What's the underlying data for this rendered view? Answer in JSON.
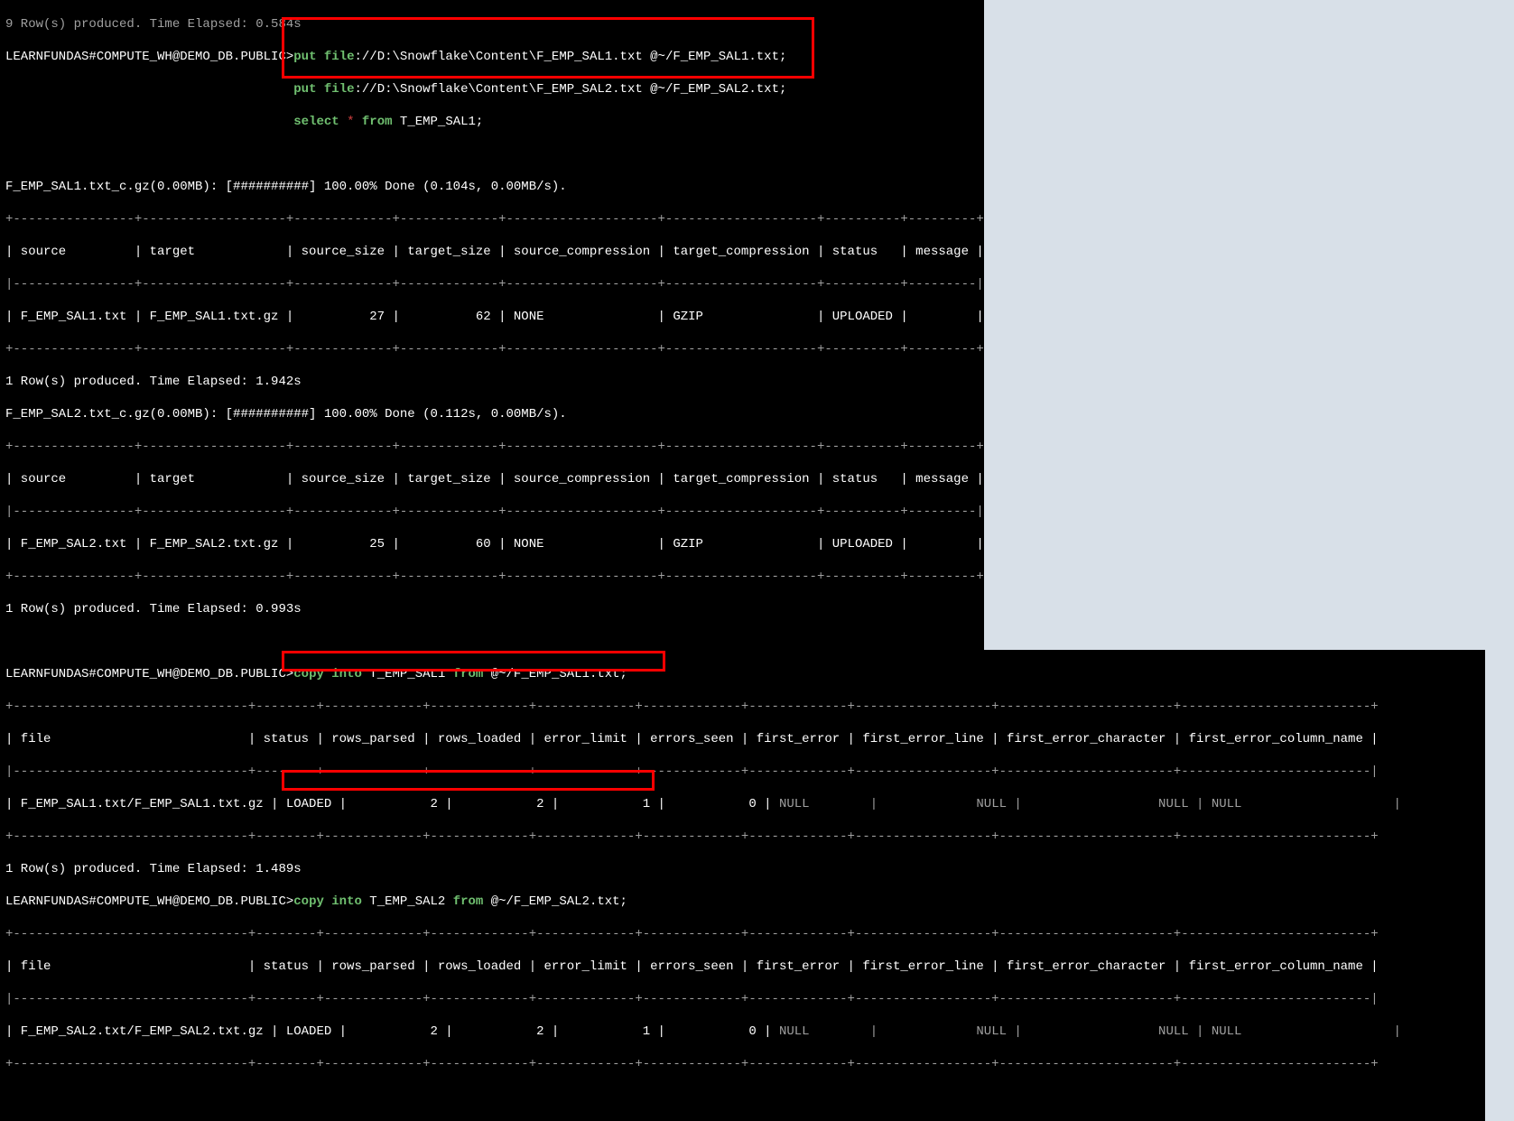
{
  "prompt_text": "LEARNFUNDAS#COMPUTE_WH@DEMO_DB.PUBLIC>",
  "top_truncated": "9 Row(s) produced. Time Elapsed: 0.584s",
  "cmd_box1": {
    "l1_kw1": "put",
    "l1_kw2": "file",
    "l1_path": "://D:\\Snowflake\\Content\\F_EMP_SAL1.txt @~/F_EMP_SAL1.txt;",
    "l2_kw1": "put",
    "l2_kw2": "file",
    "l2_path": "://D:\\Snowflake\\Content\\F_EMP_SAL2.txt @~/F_EMP_SAL2.txt;",
    "l3_kw1": "select",
    "l3_star": " * ",
    "l3_kw2": "from",
    "l3_rest": " T_EMP_SAL1;"
  },
  "upload1_status": "F_EMP_SAL1.txt_c.gz(0.00MB): [##########] 100.00% Done (0.104s, 0.00MB/s).",
  "upload_border": "+----------------+-------------------+-------------+-------------+--------------------+--------------------+----------+---------+",
  "upload_header": "| source         | target            | source_size | target_size | source_compression | target_compression | status   | message |",
  "upload_border_mid": "|----------------+-------------------+-------------+-------------+--------------------+--------------------+----------+---------|",
  "upload1_row": "| F_EMP_SAL1.txt | F_EMP_SAL1.txt.gz |          27 |          62 | NONE               | GZIP               | UPLOADED |         |",
  "upload1_time": "1 Row(s) produced. Time Elapsed: 1.942s",
  "upload2_status": "F_EMP_SAL2.txt_c.gz(0.00MB): [##########] 100.00% Done (0.112s, 0.00MB/s).",
  "upload2_row": "| F_EMP_SAL2.txt | F_EMP_SAL2.txt.gz |          25 |          60 | NONE               | GZIP               | UPLOADED |         |",
  "upload2_time": "1 Row(s) produced. Time Elapsed: 0.993s",
  "cmd_box2": {
    "kw1": "copy",
    "kw2": "into",
    "mid": " T_EMP_SAL1 ",
    "kw3": "from",
    "rest": " @~/F_EMP_SAL1.txt;"
  },
  "cmd_box3": {
    "kw1": "copy",
    "kw2": "into",
    "mid": " T_EMP_SAL2 ",
    "kw3": "from",
    "rest": " @~/F_EMP_SAL2.txt;"
  },
  "copy_border": "+-------------------------------+--------+-------------+-------------+-------------+-------------+-------------+------------------+-----------------------+-------------------------+",
  "copy_header": "| file                          | status | rows_parsed | rows_loaded | error_limit | errors_seen | first_error | first_error_line | first_error_character | first_error_column_name |",
  "copy_border_mid": "|-------------------------------+--------+-------------+-------------+-------------+-------------+-------------+------------------+-----------------------+-------------------------|",
  "copy1_row_a": "| F_EMP_SAL1.txt/F_EMP_SAL1.txt.gz | LOADED |           2 |           2 |           1 |           0 |",
  "copy2_row_a": "| F_EMP_SAL2.txt/F_EMP_SAL2.txt.gz | LOADED |           2 |           2 |           1 |           0 |",
  "null_cell_1": " NULL        |",
  "null_cell_2": "             NULL |",
  "null_cell_3": "                  NULL |",
  "null_cell_4": " NULL                    |",
  "copy1_time": "1 Row(s) produced. Time Elapsed: 1.489s"
}
